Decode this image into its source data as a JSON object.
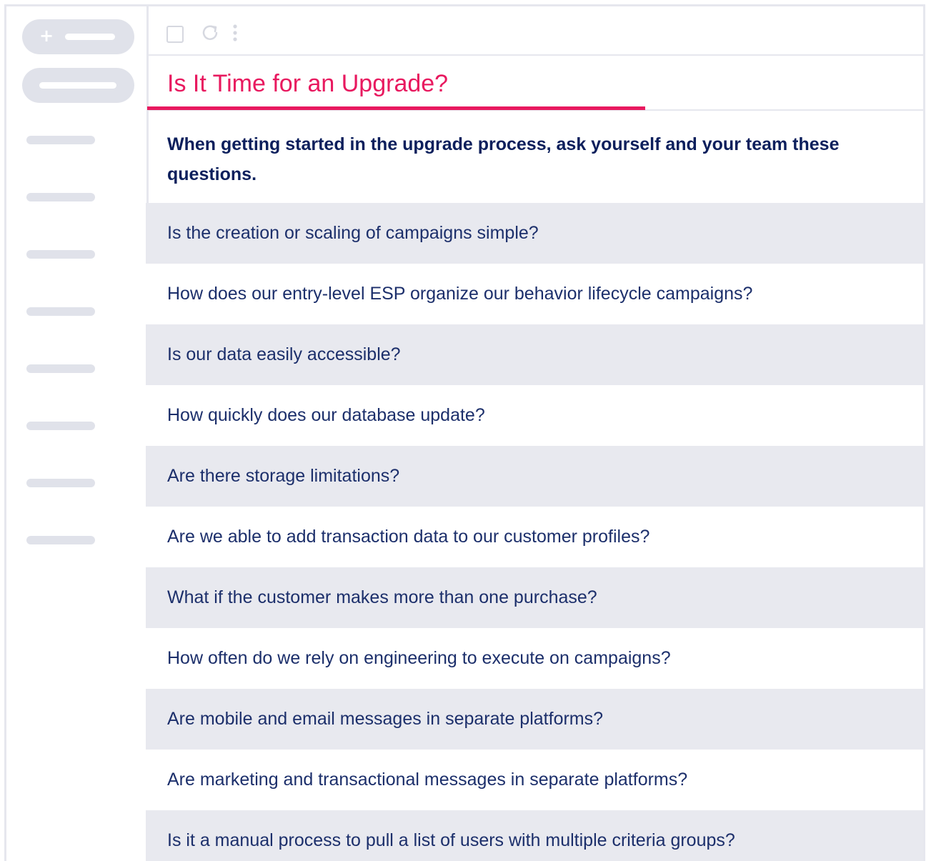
{
  "toolbar": {
    "select_icon": "checkbox-icon",
    "refresh_icon": "refresh-icon",
    "more_icon": "more-vertical-icon"
  },
  "sidebar": {
    "compose_icon": "plus-icon",
    "compose_glyph": "+"
  },
  "email": {
    "subject": "Is It Time for an Upgrade?",
    "intro": "When getting started in the upgrade process, ask yourself and your team these questions.",
    "questions": [
      "Is the creation or scaling of campaigns simple?",
      "How does our entry-level ESP organize our behavior lifecycle campaigns?",
      "Is our data easily accessible?",
      "How quickly does our database update?",
      "Are there storage limitations?",
      "Are we able to add transaction data to our customer profiles?",
      "What if the customer makes more than one purchase?",
      "How often do we rely on engineering to execute on campaigns?",
      "Are mobile and email messages in separate platforms?",
      "Are marketing and transactional messages in separate platforms?",
      "Is it a manual process to pull a list of users with multiple criteria groups?"
    ]
  },
  "colors": {
    "accent": "#e8195f",
    "heading_text": "#0c1f5c",
    "body_text": "#1c2f6b",
    "row_shade": "#e8e9ef",
    "placeholder": "#e0e2ea"
  }
}
